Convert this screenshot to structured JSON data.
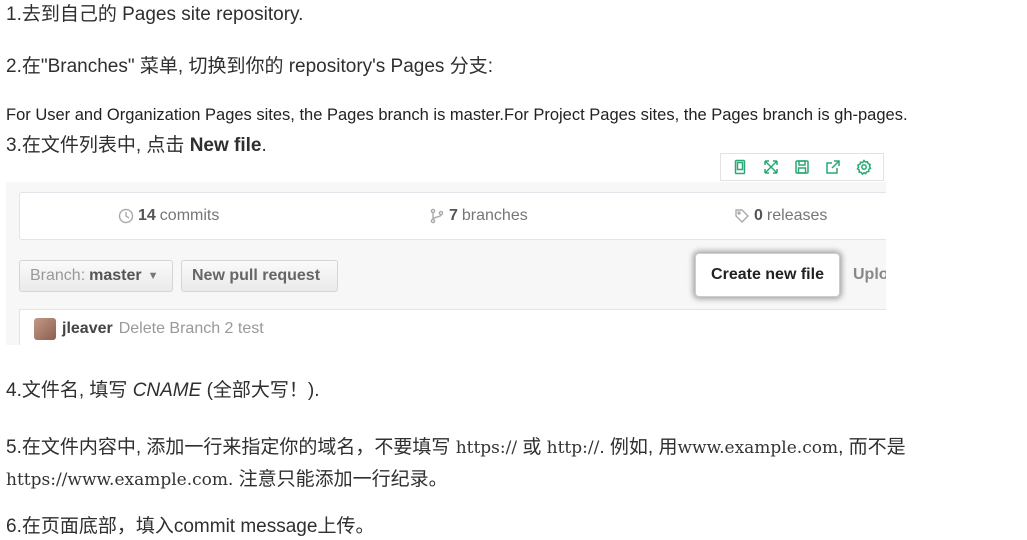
{
  "steps": {
    "s1": "1.去到自己的 Pages site repository.",
    "s2": "2.在\"Branches\" 菜单, 切换到你的 repository's Pages 分支:",
    "note": "For User and Organization Pages sites, the Pages branch is master.For Project Pages sites, the Pages branch is gh-pages.",
    "s3_pre": "3.在文件列表中, 点击 ",
    "s3_bold": "New file",
    "s3_post": ".",
    "s4_pre": "4.文件名, 填写 ",
    "s4_em": "CNAME",
    "s4_post": " (全部大写！).",
    "s5_a": "5.在文件内容中, 添加一行来指定你的域名，不要填写 ",
    "s5_code1": "https://",
    "s5_b": " 或 ",
    "s5_code2": "http://",
    "s5_c": ". 例如, 用",
    "s5_code3": "www.example.com",
    "s5_d": ", 而不是 ",
    "s5_code4": "https://www.example.com",
    "s5_e": ". 注意只能添加一行纪录。",
    "s6": "6.在页面底部，填入commit message上传。"
  },
  "toolbar": {
    "icons": [
      "mobile-icon",
      "fullscreen-icon",
      "save-icon",
      "share-icon",
      "settings-icon"
    ],
    "accent": "#2aa876"
  },
  "github": {
    "commits_count": "14",
    "commits_label": "commits",
    "branches_count": "7",
    "branches_label": "branches",
    "releases_count": "0",
    "releases_label": "releases",
    "branch_label": "Branch:",
    "branch_value": "master",
    "new_pr": "New pull request",
    "create_file": "Create new file",
    "upload": "Uplo",
    "commit_user": "jleaver",
    "commit_msg": "Delete Branch 2 test"
  }
}
